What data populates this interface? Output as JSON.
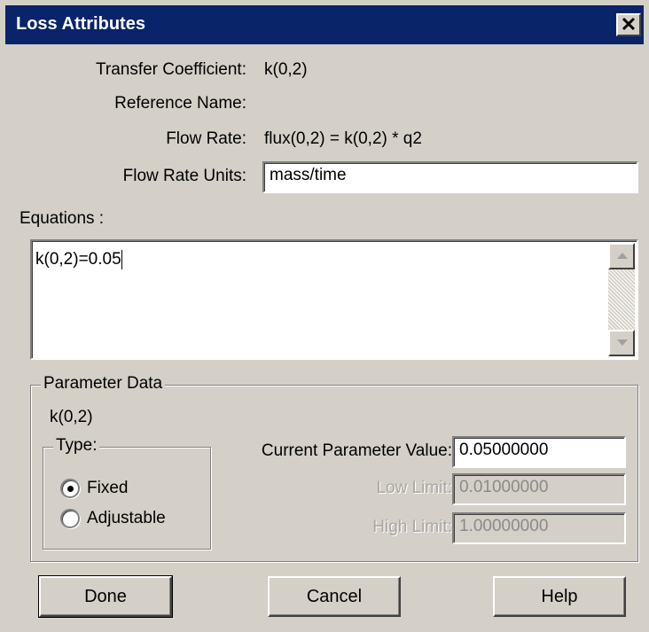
{
  "window": {
    "title": "Loss Attributes",
    "close_glyph": "✕"
  },
  "info": {
    "transfer_coefficient_label": "Transfer Coefficient:",
    "transfer_coefficient_value": "k(0,2)",
    "reference_name_label": "Reference Name:",
    "reference_name_value": "",
    "flow_rate_label": "Flow Rate:",
    "flow_rate_value": "flux(0,2) = k(0,2) * q2",
    "flow_rate_units_label": "Flow Rate Units:",
    "flow_rate_units_value": "mass/time"
  },
  "equations": {
    "label": "Equations :",
    "text": "k(0,2)=0.05"
  },
  "parameter_data": {
    "group_label": "Parameter Data",
    "parameter_name": "k(0,2)",
    "type": {
      "group_label": "Type:",
      "options": [
        {
          "label": "Fixed",
          "selected": true
        },
        {
          "label": "Adjustable",
          "selected": false
        }
      ]
    },
    "current_value_label": "Current Parameter Value:",
    "current_value": "0.05000000",
    "low_limit_label": "Low Limit:",
    "low_limit_value": "0.01000000",
    "high_limit_label": "High Limit:",
    "high_limit_value": "1.00000000"
  },
  "buttons": {
    "done": "Done",
    "cancel": "Cancel",
    "help": "Help"
  },
  "icons": {
    "scroll_up": "scroll-up-arrow-icon",
    "scroll_down": "scroll-down-arrow-icon",
    "close": "close-icon"
  },
  "colors": {
    "titlebar": "#0a246a",
    "dialog_face": "#d4d0c8"
  }
}
